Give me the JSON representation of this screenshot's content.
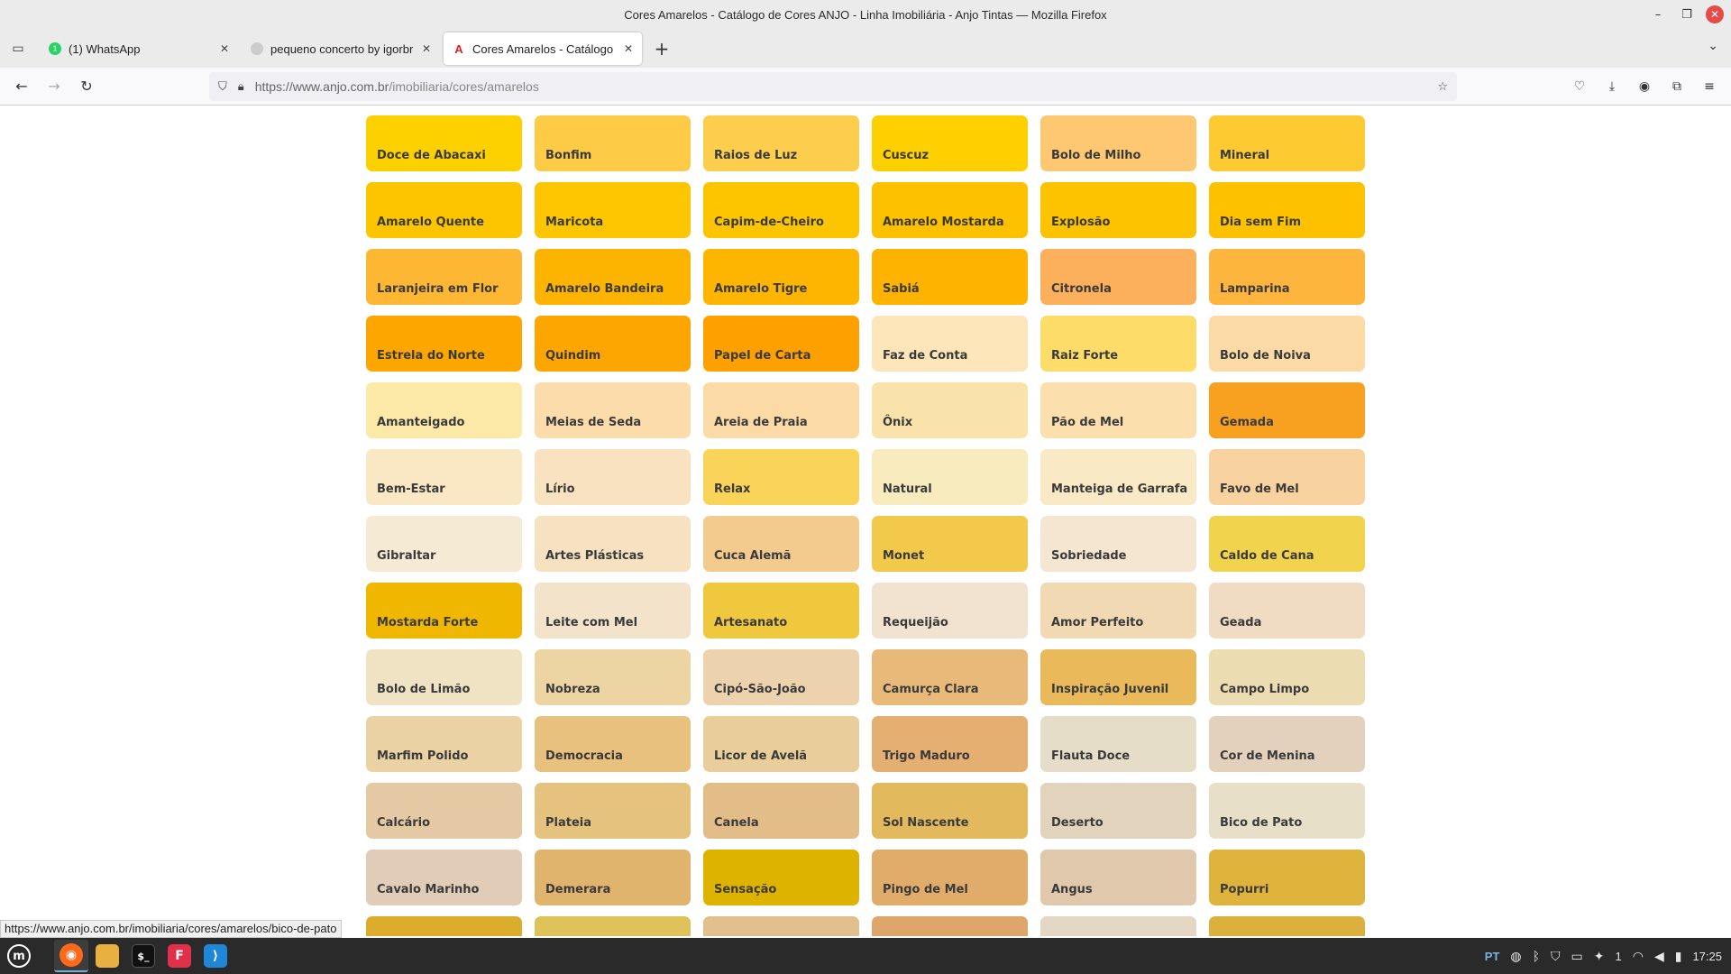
{
  "window": {
    "title": "Cores Amarelos - Catálogo de Cores ANJO - Linha Imobiliária - Anjo Tintas — Mozilla Firefox"
  },
  "tabs": [
    {
      "label": "(1) WhatsApp",
      "icon": "whatsapp-icon",
      "color": "#25d366",
      "active": false
    },
    {
      "label": "pequeno concerto by igorbr",
      "icon": "github-icon",
      "color": "#cccccc",
      "active": false
    },
    {
      "label": "Cores Amarelos - Catálogo de",
      "icon": "anjo-icon",
      "color": "#e0201f",
      "active": true
    }
  ],
  "nav": {
    "url_host": "https://www.anjo.com.br",
    "url_path": "/imobiliaria/cores/amarelos"
  },
  "status_url": "https://www.anjo.com.br/imobiliaria/cores/amarelos/bico-de-pato",
  "swatches": [
    {
      "name": "Doce de Abacaxi",
      "color": "#fdd000"
    },
    {
      "name": "Bonfim",
      "color": "#fdcb46"
    },
    {
      "name": "Raios de Luz",
      "color": "#fdcd4e"
    },
    {
      "name": "Cuscuz",
      "color": "#fed000"
    },
    {
      "name": "Bolo de Milho",
      "color": "#fec872"
    },
    {
      "name": "Mineral",
      "color": "#fdca32"
    },
    {
      "name": "Amarelo Quente",
      "color": "#fdc500"
    },
    {
      "name": "Maricota",
      "color": "#fdc600"
    },
    {
      "name": "Capim-de-Cheiro",
      "color": "#fdc500"
    },
    {
      "name": "Amarelo Mostarda",
      "color": "#fdc100"
    },
    {
      "name": "Explosão",
      "color": "#fdc300"
    },
    {
      "name": "Dia sem Fim",
      "color": "#fdc100"
    },
    {
      "name": "Laranjeira em Flor",
      "color": "#fdb733"
    },
    {
      "name": "Amarelo Bandeira",
      "color": "#fdb400"
    },
    {
      "name": "Amarelo Tigre",
      "color": "#fdb500"
    },
    {
      "name": "Sabiá",
      "color": "#fdb300"
    },
    {
      "name": "Citronela",
      "color": "#fdb05b"
    },
    {
      "name": "Lamparina",
      "color": "#fdb53e"
    },
    {
      "name": "Estrela do Norte",
      "color": "#fda600"
    },
    {
      "name": "Quindim",
      "color": "#fda500"
    },
    {
      "name": "Papel de Carta",
      "color": "#fda000"
    },
    {
      "name": "Faz de Conta",
      "color": "#fce5b8"
    },
    {
      "name": "Raiz Forte",
      "color": "#fddc6a"
    },
    {
      "name": "Bolo de Noiva",
      "color": "#fcdaa6"
    },
    {
      "name": "Amanteigado",
      "color": "#fce9a8"
    },
    {
      "name": "Meias de Seda",
      "color": "#fbdcaa"
    },
    {
      "name": "Areia de Praia",
      "color": "#fbdaa6"
    },
    {
      "name": "Ônix",
      "color": "#f9e3aa"
    },
    {
      "name": "Pão de Mel",
      "color": "#fbdfad"
    },
    {
      "name": "Gemada",
      "color": "#f8a020"
    },
    {
      "name": "Bem-Estar",
      "color": "#fae7c4"
    },
    {
      "name": "Lírio",
      "color": "#f9e2c0"
    },
    {
      "name": "Relax",
      "color": "#f9d458"
    },
    {
      "name": "Natural",
      "color": "#f8ecbe"
    },
    {
      "name": "Manteiga de Garrafa",
      "color": "#f9e9c5"
    },
    {
      "name": "Favo de Mel",
      "color": "#f8d3a0"
    },
    {
      "name": "Gibraltar",
      "color": "#f5ebd5"
    },
    {
      "name": "Artes Plásticas",
      "color": "#f6e1c0"
    },
    {
      "name": "Cuca Alemã",
      "color": "#f3cb8e"
    },
    {
      "name": "Monet",
      "color": "#f2c94a"
    },
    {
      "name": "Sobriedade",
      "color": "#f4e6d0"
    },
    {
      "name": "Caldo de Cana",
      "color": "#f2d34e"
    },
    {
      "name": "Mostarda Forte",
      "color": "#f0b700"
    },
    {
      "name": "Leite com Mel",
      "color": "#f3e3cb"
    },
    {
      "name": "Artesanato",
      "color": "#f0c83e"
    },
    {
      "name": "Requeijão",
      "color": "#f1e3cf"
    },
    {
      "name": "Amor Perfeito",
      "color": "#f0d9b3"
    },
    {
      "name": "Geada",
      "color": "#efdcc3"
    },
    {
      "name": "Bolo de Limão",
      "color": "#efe3c4"
    },
    {
      "name": "Nobreza",
      "color": "#ecd5a2"
    },
    {
      "name": "Cipó-São-João",
      "color": "#ecd2ad"
    },
    {
      "name": "Camurça Clara",
      "color": "#e9b97a"
    },
    {
      "name": "Inspiração Juvenil",
      "color": "#e9b95a"
    },
    {
      "name": "Campo Limpo",
      "color": "#ebdcb2"
    },
    {
      "name": "Marfim Polido",
      "color": "#ebd2a4"
    },
    {
      "name": "Democracia",
      "color": "#e9c17f"
    },
    {
      "name": "Licor de Avelã",
      "color": "#e9cd9a"
    },
    {
      "name": "Trigo Maduro",
      "color": "#e5af72"
    },
    {
      "name": "Flauta Doce",
      "color": "#e6ddc8"
    },
    {
      "name": "Cor de Menina",
      "color": "#e3d1bd"
    },
    {
      "name": "Calcário",
      "color": "#e5c9a5"
    },
    {
      "name": "Plateia",
      "color": "#e5c37e"
    },
    {
      "name": "Canela",
      "color": "#e3bd87"
    },
    {
      "name": "Sol Nascente",
      "color": "#e2b95c"
    },
    {
      "name": "Deserto",
      "color": "#e1d3bc"
    },
    {
      "name": "Bico de Pato",
      "color": "#e8dfc8"
    },
    {
      "name": "Cavalo Marinho",
      "color": "#e0ccb7"
    },
    {
      "name": "Demerara",
      "color": "#e0b46c"
    },
    {
      "name": "Sensação",
      "color": "#deb300"
    },
    {
      "name": "Pingo de Mel",
      "color": "#e1ac6a"
    },
    {
      "name": "Angus",
      "color": "#dfc8ab"
    },
    {
      "name": "Popurri",
      "color": "#deb43c"
    },
    {
      "name": "",
      "color": "#dcac2c"
    },
    {
      "name": "",
      "color": "#e0c25a"
    },
    {
      "name": "",
      "color": "#e2c08e"
    },
    {
      "name": "",
      "color": "#dea66a"
    },
    {
      "name": "",
      "color": "#e4d8c4"
    },
    {
      "name": "",
      "color": "#dcb03c"
    }
  ],
  "taskbar": {
    "lang": "PT",
    "workspace": "1",
    "clock": "17:25",
    "apps": [
      {
        "name": "mint-menu-icon",
        "color": "#2a2a2a",
        "glyph": "m"
      },
      {
        "name": "firefox-icon",
        "color": "#ff6a1a",
        "glyph": "◉"
      },
      {
        "name": "files-icon",
        "color": "#e8b040",
        "glyph": "▬"
      },
      {
        "name": "terminal-icon",
        "color": "#111111",
        "glyph": "$"
      },
      {
        "name": "text-editor-icon",
        "color": "#e0304a",
        "glyph": "F"
      },
      {
        "name": "vscode-icon",
        "color": "#1f87d6",
        "glyph": "⟩"
      }
    ]
  }
}
